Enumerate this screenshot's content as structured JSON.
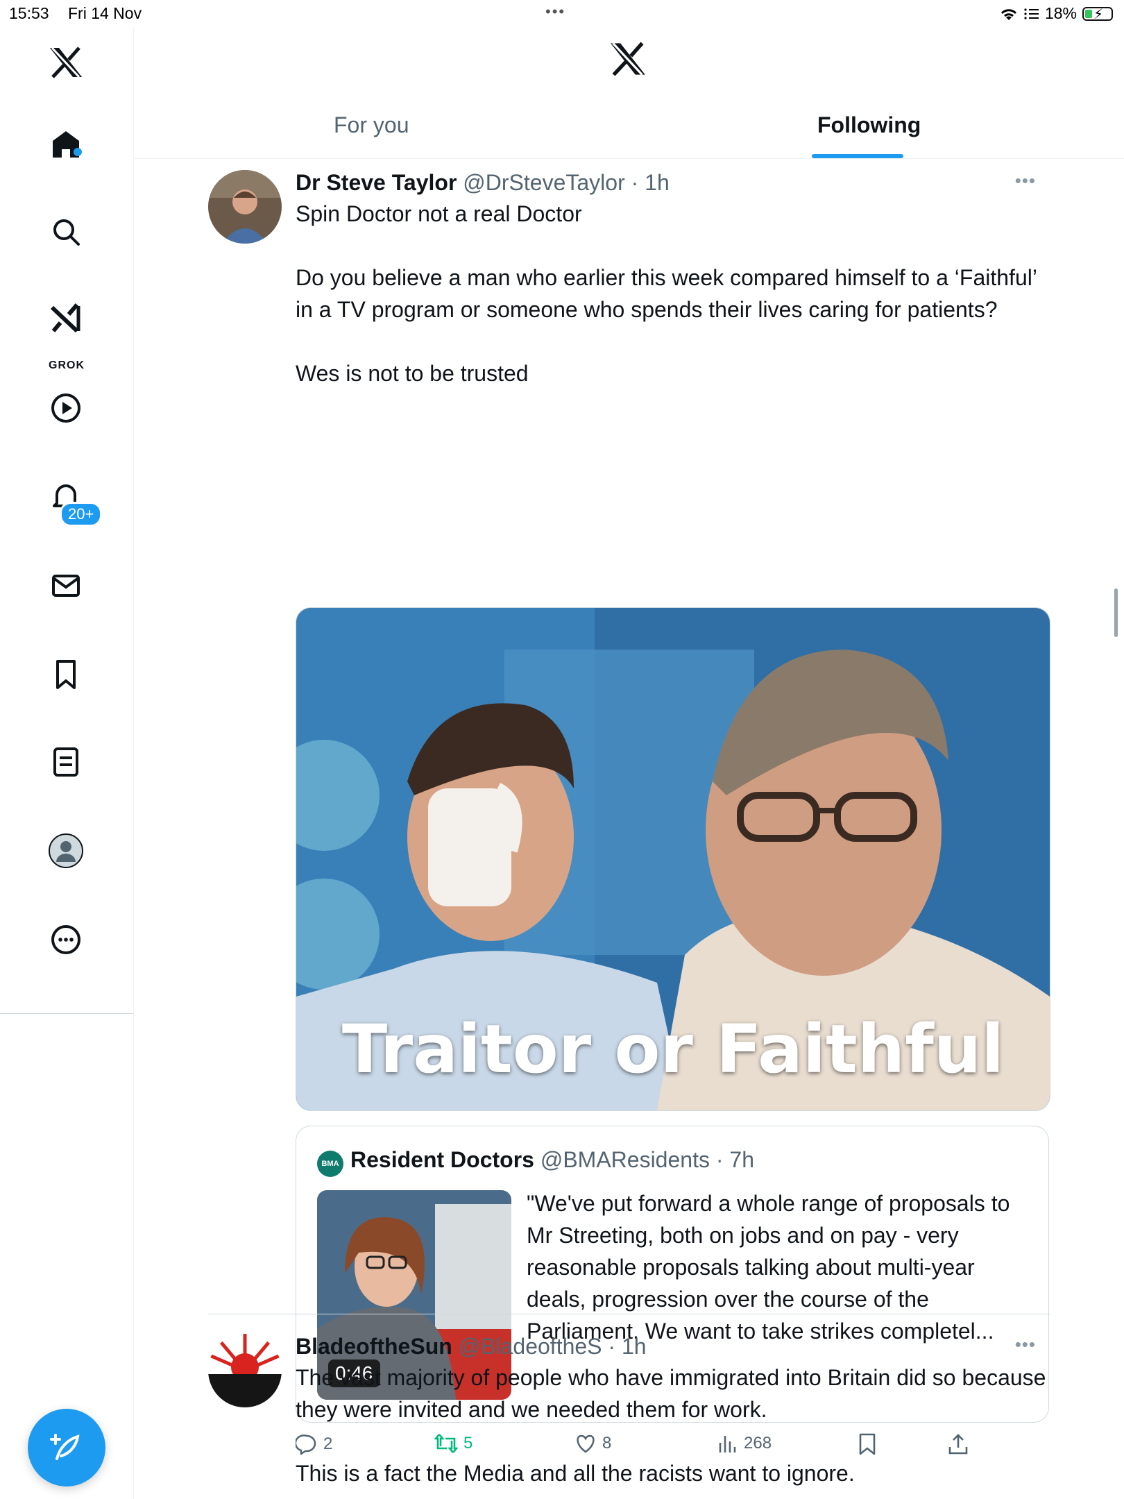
{
  "status_bar": {
    "time": "15:53",
    "date": "Fri 14 Nov",
    "battery": "18%"
  },
  "sidebar": {
    "grok_label": "GROK",
    "notifications_badge": "20+"
  },
  "header": {
    "tabs": [
      {
        "label": "For you"
      },
      {
        "label": "Following"
      }
    ]
  },
  "tweets": [
    {
      "name": "Dr Steve Taylor",
      "meta": "@DrSteveTaylor · 1h",
      "text": "Spin Doctor not a real Doctor\n\nDo you believe a man who earlier this week compared himself to a ‘Faithful’ in a TV program or someone who spends their lives caring for patients?\n\nWes is not to be trusted",
      "image_text": "Traitor or Faithful",
      "quote": {
        "name": "Resident Doctors",
        "meta": "@BMAResidents · 7h",
        "logo_text": "BMA",
        "duration": "0:46",
        "text": "\"We've put forward a whole range of proposals to Mr Streeting, both on jobs and on pay - very reasonable proposals talking about multi-year deals, progression over the course of the Parliament. We want to take strikes completel..."
      },
      "actions": {
        "replies": "2",
        "reposts": "5",
        "likes": "8",
        "views": "268"
      }
    },
    {
      "name": "BladeoftheSun",
      "meta": "@BladeoftheS · 1h",
      "text": "The vast majority of people who have immigrated into Britain did so because they were invited and we needed them for work.\n\nThis is a fact the Media and all the racists want to ignore."
    }
  ]
}
